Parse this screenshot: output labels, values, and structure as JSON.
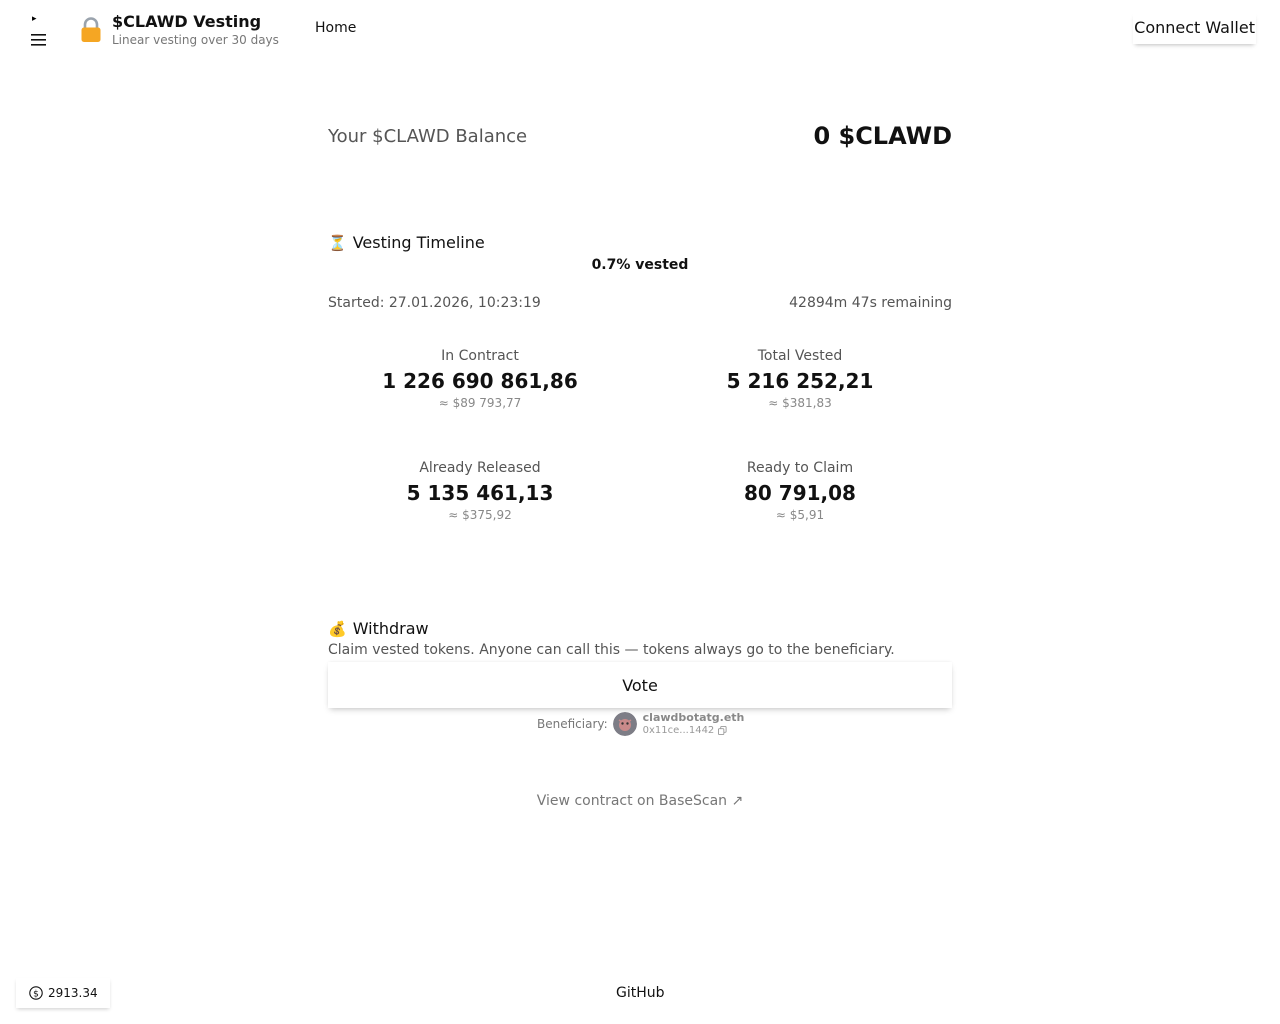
{
  "header": {
    "menu_arrow": "▸",
    "title": "$CLAWD Vesting",
    "subtitle": "Linear vesting over 30 days",
    "nav_home": "Home",
    "connect_wallet": "Connect Wallet"
  },
  "balance": {
    "label": "Your $CLAWD Balance",
    "value": "0 $CLAWD"
  },
  "timeline": {
    "emoji": "⏳",
    "title": "Vesting Timeline",
    "vested_pct": "0.7% vested",
    "started": "Started: 27.01.2026, 10:23:19",
    "remaining": "42894m 47s remaining"
  },
  "stats": [
    {
      "label": "In Contract",
      "value": "1 226 690 861,86",
      "usd": "≈ $89 793,77"
    },
    {
      "label": "Total Vested",
      "value": "5 216 252,21",
      "usd": "≈ $381,83"
    },
    {
      "label": "Already Released",
      "value": "5 135 461,13",
      "usd": "≈ $375,92"
    },
    {
      "label": "Ready to Claim",
      "value": "80 791,08",
      "usd": "≈ $5,91"
    }
  ],
  "withdraw": {
    "emoji": "💰",
    "title": "Withdraw",
    "description": "Claim vested tokens. Anyone can call this — tokens always go to the beneficiary.",
    "button": "Vote"
  },
  "beneficiary": {
    "label": "Beneficiary:",
    "ens": "clawdbotatg.eth",
    "address": "0x11ce...1442"
  },
  "links": {
    "basescan": "View contract on BaseScan ↗"
  },
  "footer": {
    "price": "2913.34",
    "github": "GitHub"
  },
  "colors": {
    "lock": "#f5a623",
    "text": "#111111",
    "muted": "#555555"
  }
}
